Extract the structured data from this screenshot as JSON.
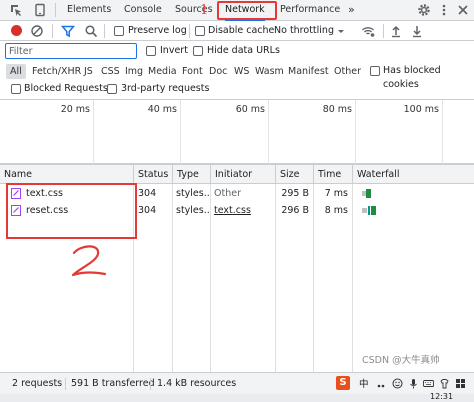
{
  "devtools": {
    "tabs": [
      "Elements",
      "Console",
      "Sources",
      "Network",
      "Performance"
    ],
    "more_tabs": "»"
  },
  "toolbar": {
    "preserve_log": "Preserve log",
    "disable_cache": "Disable cache",
    "throttling": "No throttling"
  },
  "filter": {
    "placeholder": "Filter",
    "invert": "Invert",
    "hide_data_urls": "Hide data URLs"
  },
  "types": [
    "All",
    "Fetch/XHR",
    "JS",
    "CSS",
    "Img",
    "Media",
    "Font",
    "Doc",
    "WS",
    "Wasm",
    "Manifest",
    "Other"
  ],
  "blocked_cookies": "Has blocked cookies",
  "blocked_requests": "Blocked Requests",
  "third_party": "3rd-party requests",
  "overview": {
    "ticks": [
      "20 ms",
      "40 ms",
      "60 ms",
      "80 ms",
      "100 ms"
    ]
  },
  "table": {
    "headers": [
      "Name",
      "Status",
      "Type",
      "Initiator",
      "Size",
      "Time",
      "Waterfall"
    ],
    "rows": [
      {
        "name": "text.css",
        "status": "304",
        "type": "styles...",
        "initiator": "Other",
        "size": "295 B",
        "time": "7 ms"
      },
      {
        "name": "reset.css",
        "status": "304",
        "type": "styles...",
        "initiator": "text.css",
        "size": "296 B",
        "time": "8 ms"
      }
    ]
  },
  "statusbar": {
    "requests": "2 requests",
    "transferred": "591 B transferred",
    "resources": "1.4 kB resources"
  },
  "annotations": {
    "one": "1",
    "two": "2"
  },
  "watermark": "CSDN @大牛真帅",
  "taskbar": {
    "time": "12:31",
    "ime": "中"
  },
  "colors": {
    "accent": "#1a73e8",
    "record": "#d93025",
    "annotation": "#e53935",
    "waterfall_green": "#1e8e3e",
    "waterfall_teal": "#009688"
  }
}
